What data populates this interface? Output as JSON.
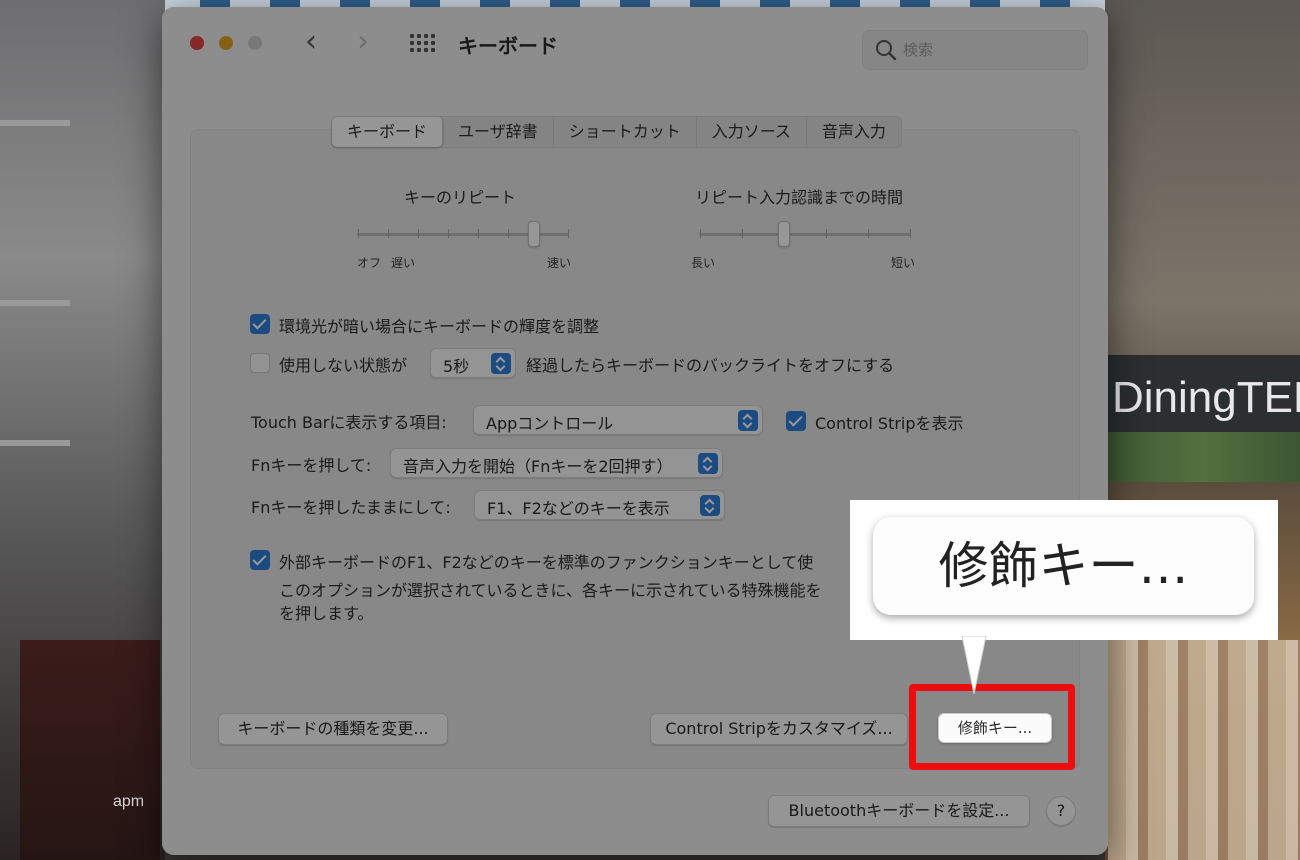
{
  "background": {
    "sign_text": "DiningTERR",
    "logo_text": "apm"
  },
  "window": {
    "title": "キーボード",
    "search_placeholder": "検索"
  },
  "tabs": [
    {
      "label": "キーボード",
      "active": true
    },
    {
      "label": "ユーザ辞書",
      "active": false
    },
    {
      "label": "ショートカット",
      "active": false
    },
    {
      "label": "入力ソース",
      "active": false
    },
    {
      "label": "音声入力",
      "active": false
    }
  ],
  "key_repeat": {
    "title": "キーのリピート",
    "label_off": "オフ",
    "label_slow": "遅い",
    "label_fast": "速い"
  },
  "delay_until_repeat": {
    "title": "リピート入力認識までの時間",
    "label_long": "長い",
    "label_short": "短い"
  },
  "options": {
    "adjust_brightness": {
      "label": "環境光が暗い場合にキーボードの輝度を調整",
      "checked": true
    },
    "backlight_off": {
      "checked": false,
      "prefix": "使用しない状態が",
      "value": "5秒",
      "suffix": "経過したらキーボードのバックライトをオフにする"
    },
    "touch_bar": {
      "label": "Touch Barに表示する項目:",
      "value": "Appコントロール"
    },
    "control_strip": {
      "label": "Control Stripを表示",
      "checked": true
    },
    "fn_press": {
      "label": "Fnキーを押して:",
      "value": "音声入力を開始（Fnキーを2回押す）"
    },
    "fn_hold": {
      "label": "Fnキーを押したままにして:",
      "value": "F1、F2などのキーを表示"
    },
    "function_keys": {
      "checked": true,
      "label": "外部キーボードのF1、F2などのキーを標準のファンクションキーとして使",
      "desc_line1": "このオプションが選択されているときに、各キーに示されている特殊機能を",
      "desc_line2": "を押します。"
    }
  },
  "buttons": {
    "change_keyboard_type": "キーボードの種類を変更...",
    "customize_control_strip": "Control Stripをカスタマイズ...",
    "modifier_keys": "修飾キー...",
    "setup_bluetooth": "Bluetoothキーボードを設定...",
    "help": "?"
  },
  "callout": {
    "text": "修飾キー…",
    "highlight_color": "#ee0d0d"
  }
}
